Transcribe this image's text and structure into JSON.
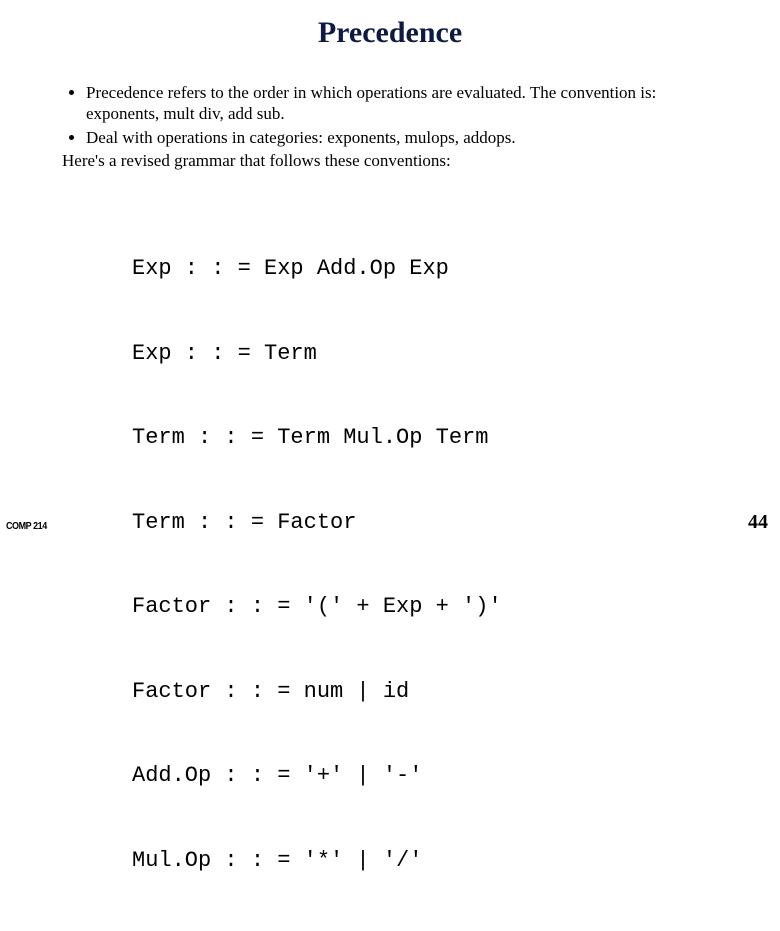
{
  "slide": {
    "title": "Precedence",
    "bullets": [
      "Precedence refers to the order in which operations are evaluated.  The convention is: exponents, mult div, add sub.",
      "Deal with operations in categories: exponents, mulops, addops."
    ],
    "post_bullets": "Here's a revised grammar that follows these conventions:",
    "grammar_lines": [
      "Exp : : = Exp Add.Op Exp",
      "Exp : : = Term",
      "Term : : = Term Mul.Op Term",
      "Term : : = Factor",
      "Factor : : = '(' + Exp + ')'",
      "Factor : : = num | id",
      "Add.Op : : = '+' | '-'",
      "Mul.Op : : = '*' | '/'"
    ],
    "footer_left": "COMP 214",
    "page_number": "44"
  }
}
